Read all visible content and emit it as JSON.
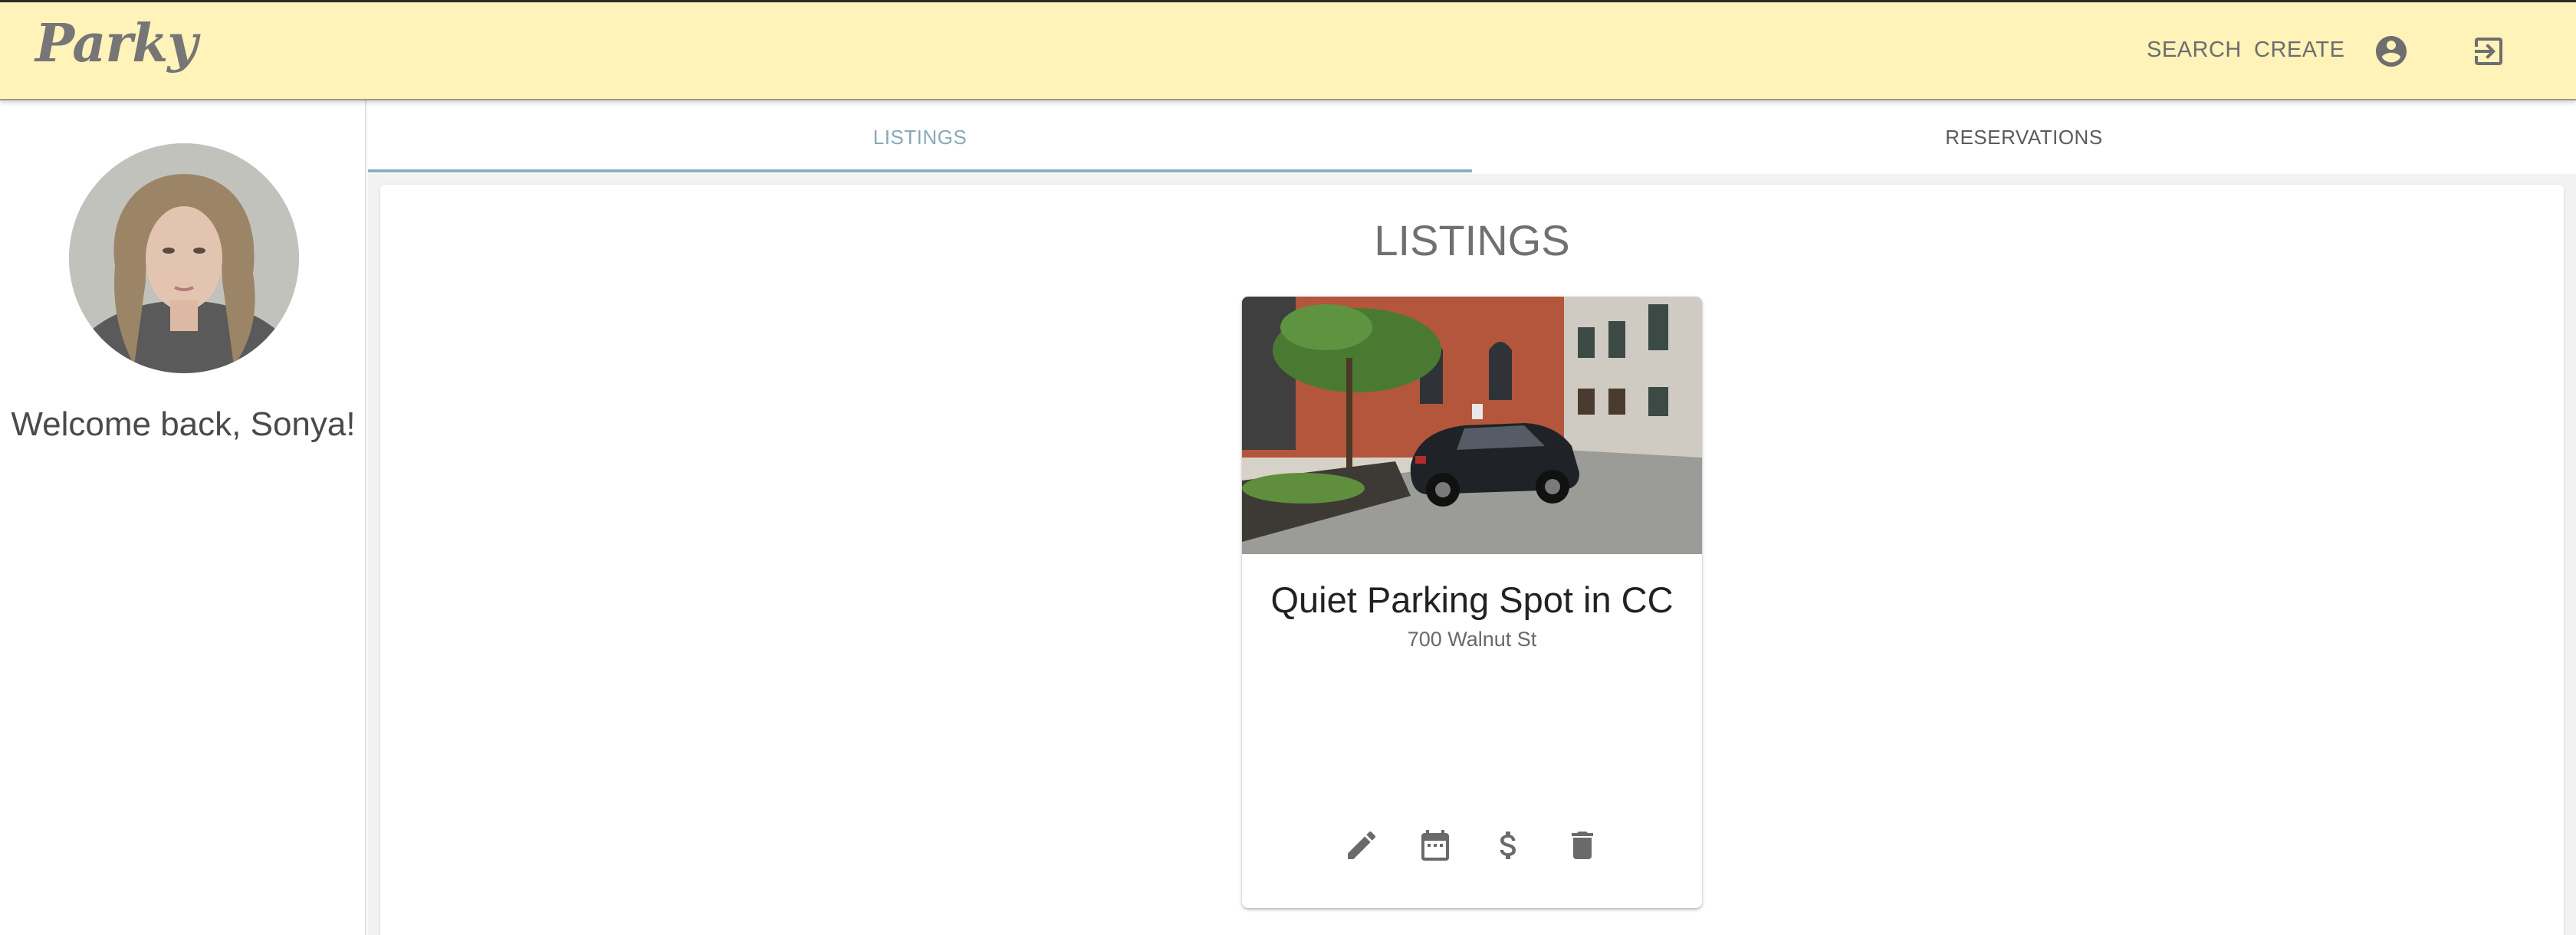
{
  "header": {
    "logo": "Parky",
    "nav": {
      "search": "SEARCH",
      "create": "CREATE"
    },
    "icons": {
      "account": "account-circle-icon",
      "logout": "exit-to-app-icon"
    },
    "background_color": "#fff3b9"
  },
  "sidebar": {
    "avatar": "user-avatar-photo",
    "welcome": "Welcome back, Sonya!"
  },
  "tabs": {
    "listings": "LISTINGS",
    "reservations": "RESERVATIONS",
    "active": "LISTINGS",
    "accent_color": "#8ab0c1"
  },
  "listings_panel": {
    "title": "LISTINGS",
    "cards": [
      {
        "image": "parking-spot-photo",
        "title": "Quiet Parking Spot in CC",
        "address": "700 Walnut St",
        "actions": [
          "edit-icon",
          "calendar-icon",
          "dollar-icon",
          "delete-icon"
        ]
      }
    ]
  }
}
